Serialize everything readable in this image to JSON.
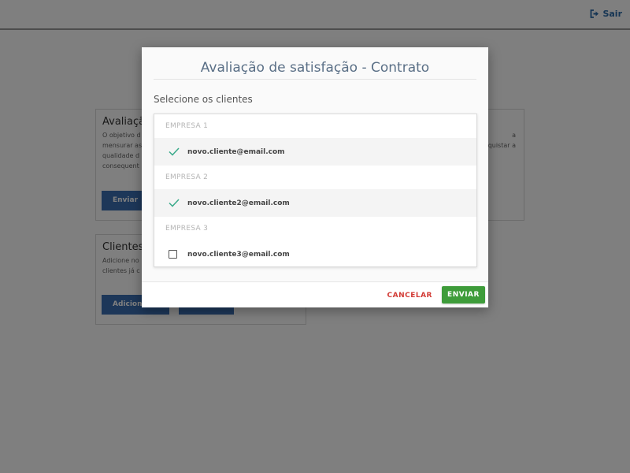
{
  "header": {
    "logout_label": "Sair"
  },
  "background": {
    "card1": {
      "title": "Avaliaçã",
      "text": "O objetivo d\nmensurar as\nqualidade d\nconsequent",
      "button": "Enviar"
    },
    "card2": {
      "text": "a\nquistar a"
    },
    "card3": {
      "title": "Clientes",
      "text": "Adicione no\nclientes já c",
      "button": "Adiciona"
    }
  },
  "modal": {
    "title": "Avaliação de satisfação - Contrato",
    "select_label": "Selecione os clientes",
    "groups": [
      {
        "company": "EMPRESA 1",
        "email": "novo.cliente@email.com",
        "checked": true
      },
      {
        "company": "EMPRESA 2",
        "email": "novo.cliente2@email.com",
        "checked": true
      },
      {
        "company": "EMPRESA 3",
        "email": "novo.cliente3@email.com",
        "checked": false
      }
    ],
    "cancel_label": "CANCELAR",
    "send_label": "ENVIAR"
  },
  "colors": {
    "check": "#3aaa8a",
    "primary_button": "#3e9c3a",
    "cancel_text": "#d23b35",
    "link": "#2a6aa8"
  }
}
